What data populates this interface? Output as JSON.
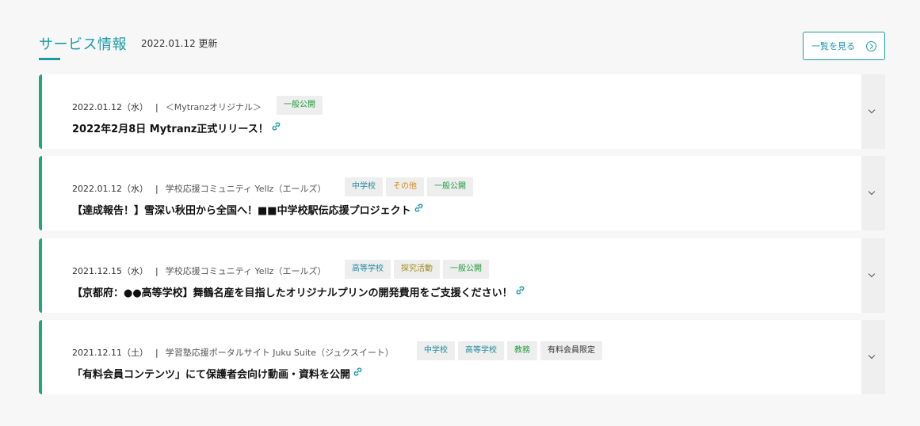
{
  "section": {
    "title": "サービス情報",
    "updated": "2022.01.12 更新",
    "all_button_label": "一覧を見る"
  },
  "colors": {
    "accent": "#1e9aa6",
    "card_border": "#20a77d",
    "tag_blue": "#1e8aa0",
    "tag_green": "#1f9a3a",
    "tag_orange": "#d48a1a"
  },
  "news": [
    {
      "date": "2022.01.12（水）",
      "separator": "|",
      "source": "＜Mytranzオリジナル＞",
      "tags": [
        {
          "label": "一般公開",
          "color": "green"
        }
      ],
      "headline": "2022年2月8日 Mytranz正式リリース！"
    },
    {
      "date": "2022.01.12（水）",
      "separator": "|",
      "source": "学校応援コミュニティ Yellz（エールズ）",
      "tags": [
        {
          "label": "中学校",
          "color": "blue"
        },
        {
          "label": "その他",
          "color": "orange"
        },
        {
          "label": "一般公開",
          "color": "green"
        }
      ],
      "headline": "【達成報告！】雪深い秋田から全国へ！■■中学校駅伝応援プロジェクト"
    },
    {
      "date": "2021.12.15（水）",
      "separator": "|",
      "source": "学校応援コミュニティ Yellz（エールズ）",
      "tags": [
        {
          "label": "高等学校",
          "color": "blue"
        },
        {
          "label": "探究活動",
          "color": "olive"
        },
        {
          "label": "一般公開",
          "color": "green"
        }
      ],
      "headline": "【京都府：●●高等学校】舞鶴名産を目指したオリジナルプリンの開発費用をご支援ください！"
    },
    {
      "date": "2021.12.11（土）",
      "separator": "|",
      "source": "学習塾応援ポータルサイト Juku Suite（ジュクスイート）",
      "tags": [
        {
          "label": "中学校",
          "color": "blue"
        },
        {
          "label": "高等学校",
          "color": "blue"
        },
        {
          "label": "教務",
          "color": "green"
        },
        {
          "label": "有料会員限定",
          "color": "gray"
        }
      ],
      "headline": "「有料会員コンテンツ」にて保護者会向け動画・資料を公開"
    }
  ]
}
